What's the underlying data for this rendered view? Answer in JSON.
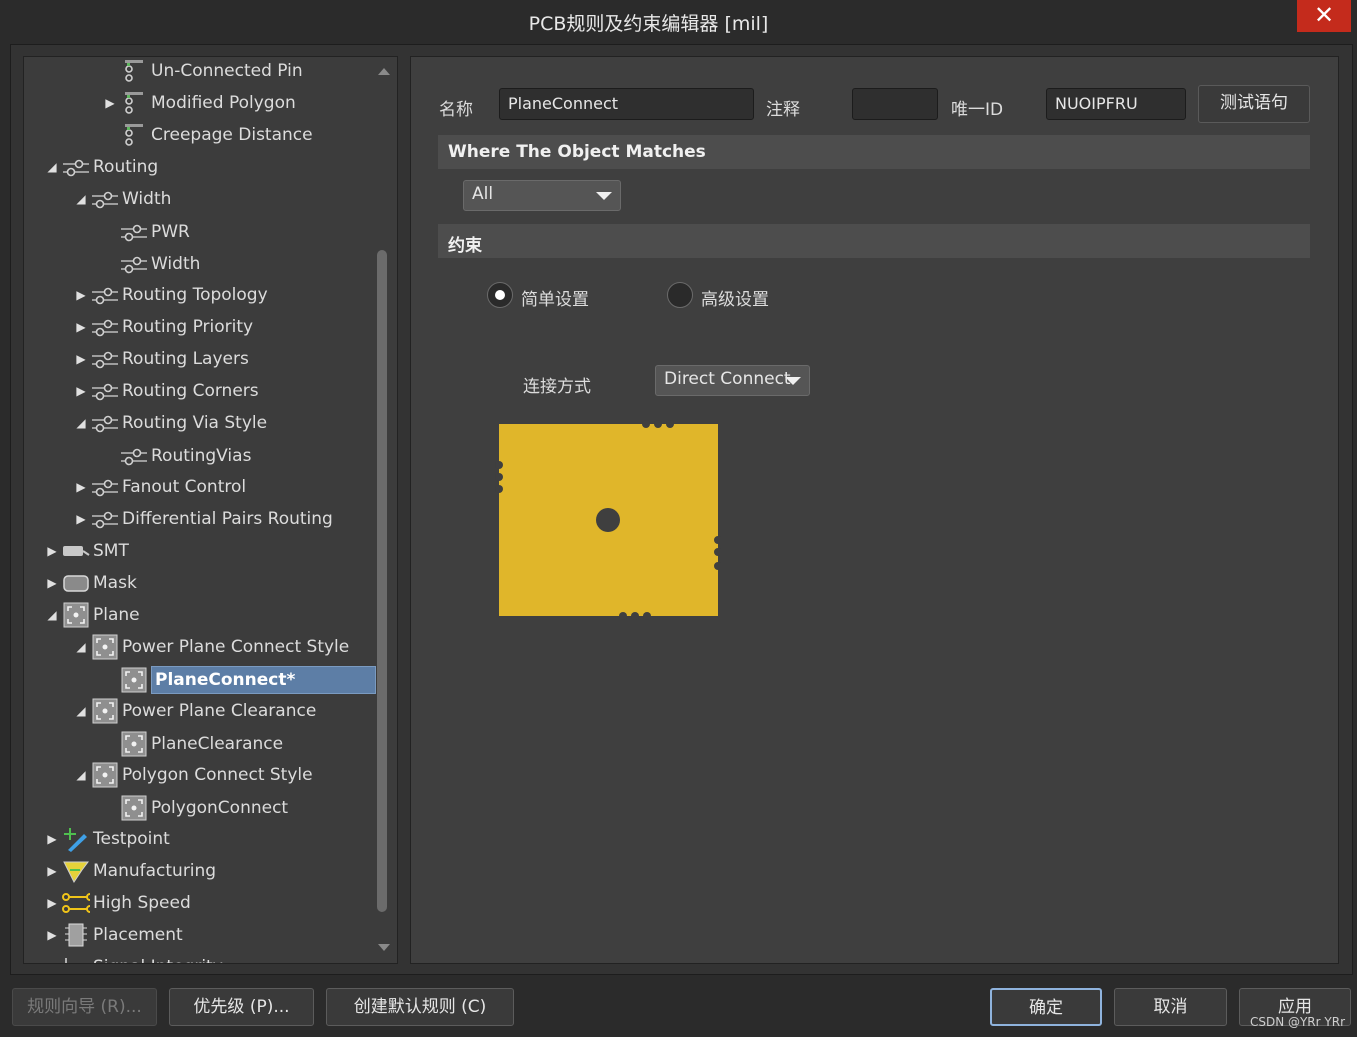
{
  "window": {
    "title": "PCB规则及约束编辑器 [mil]",
    "close_glyph": "✕"
  },
  "tree": {
    "items": [
      {
        "label": "Un-Connected Pin",
        "icon": "clearance-icon",
        "arrow": ""
      },
      {
        "label": "Modified Polygon",
        "icon": "clearance-icon",
        "arrow": "▶"
      },
      {
        "label": "Creepage Distance",
        "icon": "clearance-icon",
        "arrow": ""
      },
      {
        "label": "Routing",
        "icon": "routing-icon",
        "arrow": "◢"
      },
      {
        "label": "Width",
        "icon": "routing-icon",
        "arrow": "◢"
      },
      {
        "label": "PWR",
        "icon": "routing-icon",
        "arrow": ""
      },
      {
        "label": "Width",
        "icon": "routing-icon",
        "arrow": ""
      },
      {
        "label": "Routing Topology",
        "icon": "routing-icon",
        "arrow": "▶"
      },
      {
        "label": "Routing Priority",
        "icon": "routing-icon",
        "arrow": "▶"
      },
      {
        "label": "Routing Layers",
        "icon": "routing-icon",
        "arrow": "▶"
      },
      {
        "label": "Routing Corners",
        "icon": "routing-icon",
        "arrow": "▶"
      },
      {
        "label": "Routing Via Style",
        "icon": "routing-icon",
        "arrow": "◢"
      },
      {
        "label": "RoutingVias",
        "icon": "routing-icon",
        "arrow": ""
      },
      {
        "label": "Fanout Control",
        "icon": "routing-icon",
        "arrow": "▶"
      },
      {
        "label": "Differential Pairs Routing",
        "icon": "routing-icon",
        "arrow": "▶"
      },
      {
        "label": "SMT",
        "icon": "smt-icon",
        "arrow": "▶"
      },
      {
        "label": "Mask",
        "icon": "mask-icon",
        "arrow": "▶"
      },
      {
        "label": "Plane",
        "icon": "plane-icon",
        "arrow": "◢"
      },
      {
        "label": "Power Plane Connect Style",
        "icon": "plane-icon",
        "arrow": "◢"
      },
      {
        "label": "PlaneConnect*",
        "icon": "plane-icon",
        "arrow": ""
      },
      {
        "label": "Power Plane Clearance",
        "icon": "plane-icon",
        "arrow": "◢"
      },
      {
        "label": "PlaneClearance",
        "icon": "plane-icon",
        "arrow": ""
      },
      {
        "label": "Polygon Connect Style",
        "icon": "plane-icon",
        "arrow": "◢"
      },
      {
        "label": "PolygonConnect",
        "icon": "plane-icon",
        "arrow": ""
      },
      {
        "label": "Testpoint",
        "icon": "testpoint-icon",
        "arrow": "▶"
      },
      {
        "label": "Manufacturing",
        "icon": "manufacturing-icon",
        "arrow": "▶"
      },
      {
        "label": "High Speed",
        "icon": "high-speed-icon",
        "arrow": "▶"
      },
      {
        "label": "Placement",
        "icon": "placement-icon",
        "arrow": "▶"
      },
      {
        "label": "Signal Integrity",
        "icon": "signal-integrity-icon",
        "arrow": "▶"
      }
    ]
  },
  "form": {
    "name_label": "名称",
    "name_value": "PlaneConnect",
    "comment_label": "注释",
    "comment_value": "",
    "uid_label": "唯一ID",
    "uid_value": "NUOIPFRU",
    "test_button": "测试语句"
  },
  "match": {
    "header": "Where The Object Matches",
    "scope_value": "All"
  },
  "constraints": {
    "header": "约束",
    "simple_label": "简单设置",
    "advanced_label": "高级设置",
    "connect_label": "连接方式",
    "connect_value": "Direct Connect",
    "plane_color": "#e0b62a"
  },
  "footer": {
    "wizard_button": "规则向导 (R)...",
    "priority_button": "优先级 (P)...",
    "default_rules_button": "创建默认规则 (C)",
    "ok_button": "确定",
    "cancel_button": "取消",
    "apply_button": "应用",
    "watermark": "CSDN @YRr YRr"
  }
}
